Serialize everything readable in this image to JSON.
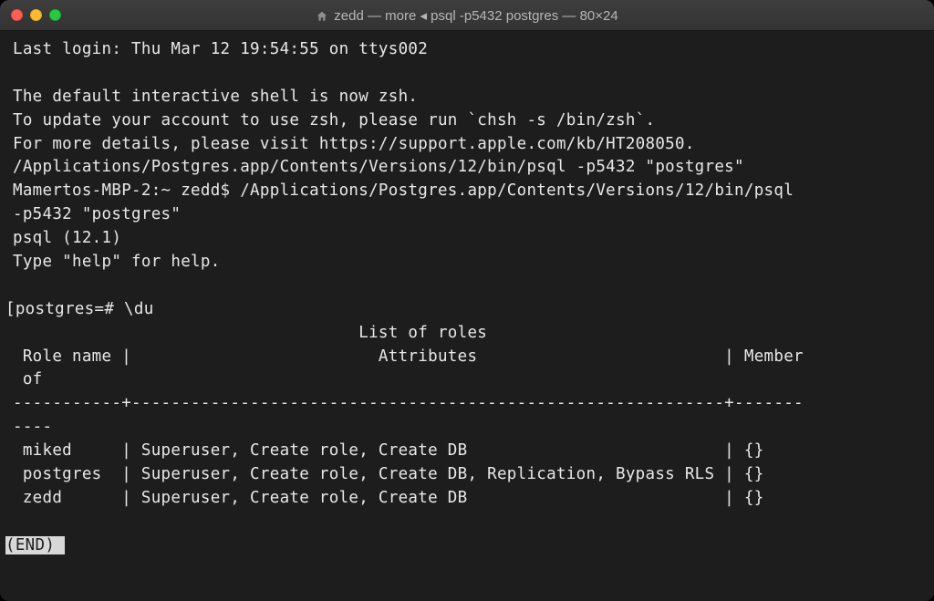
{
  "window": {
    "title": "zedd — more ◂ psql -p5432 postgres — 80×24"
  },
  "last_login": "Last login: Thu Mar 12 19:54:55 on ttys002",
  "zsh_notice": {
    "l1": "The default interactive shell is now zsh.",
    "l2": "To update your account to use zsh, please run `chsh -s /bin/zsh`.",
    "l3": "For more details, please visit https://support.apple.com/kb/HT208050."
  },
  "cmd1": "/Applications/Postgres.app/Contents/Versions/12/bin/psql -p5432 \"postgres\"",
  "prompt_line": "Mamertos-MBP-2:~ zedd$ /Applications/Postgres.app/Contents/Versions/12/bin/psql",
  "prompt_line2": "-p5432 \"postgres\"",
  "psql_version": "psql (12.1)",
  "psql_help": "Type \"help\" for help.",
  "psql_prompt": "[postgres=# \\du",
  "table": {
    "title": "                                   List of roles",
    "header1": " Role name |                         Attributes                         | Member",
    "header2": " of",
    "divider": "-----------+------------------------------------------------------------+-------",
    "divider2": "----",
    "rows": [
      " miked     | Superuser, Create role, Create DB                          | {}",
      " postgres  | Superuser, Create role, Create DB, Replication, Bypass RLS | {}",
      " zedd      | Superuser, Create role, Create DB                          | {}"
    ]
  },
  "end": "(END)"
}
